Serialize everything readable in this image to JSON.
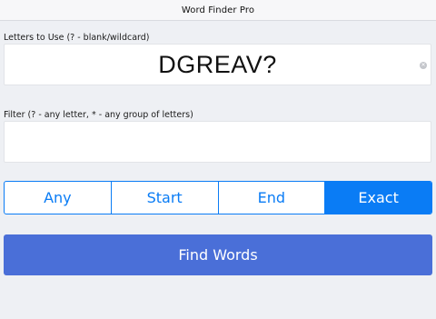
{
  "app": {
    "title": "Word Finder Pro"
  },
  "letters": {
    "label": "Letters to Use (? - blank/wildcard)",
    "value": "DGREAV?",
    "clear_icon": "clear-circle-icon"
  },
  "filter": {
    "label": "Filter (? - any letter, * - any group of letters)",
    "value": ""
  },
  "mode": {
    "options": [
      "Any",
      "Start",
      "End",
      "Exact"
    ],
    "selected": "Exact"
  },
  "actions": {
    "find_label": "Find Words"
  },
  "colors": {
    "accent": "#0a7cf5",
    "find_button": "#4a6fd8",
    "background": "#eef0f4"
  }
}
